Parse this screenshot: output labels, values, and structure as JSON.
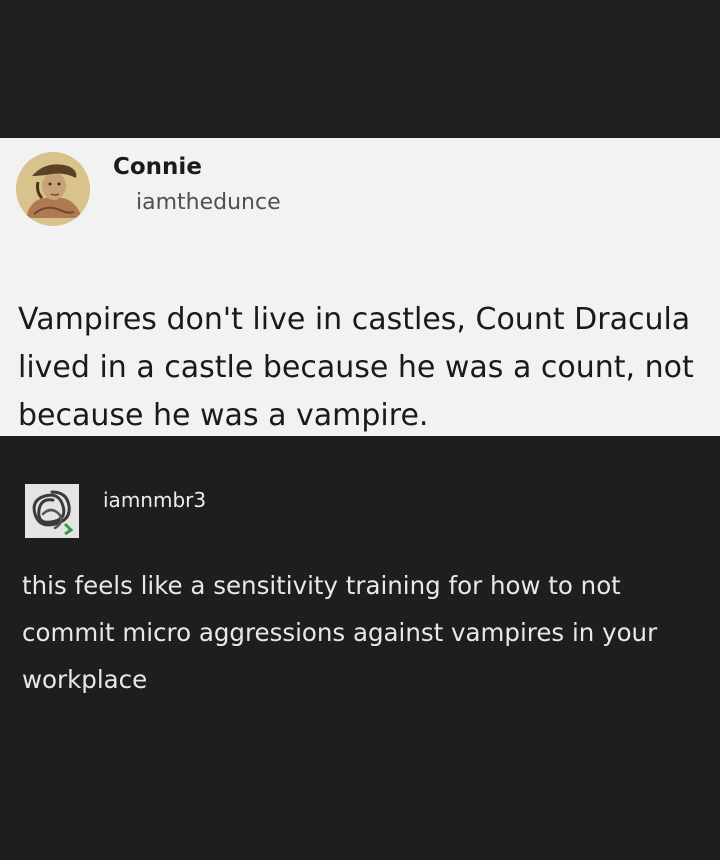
{
  "original_post": {
    "display_name": "Connie",
    "username": "iamthedunce",
    "text": "Vampires don't live in castles, Count Dracula lived in a castle because he was a count, not because he was a vampire.",
    "avatar_icon": "portrait-avatar-icon"
  },
  "reply": {
    "username": "iamnmbr3",
    "text": "this feels like a sensitivity training for how to not commit micro aggressions against vampires in your workplace",
    "avatar_icon": "knot-avatar-icon"
  },
  "colors": {
    "background_dark": "#1e1e1e",
    "card_light": "#f2f2f2",
    "text_dark": "#1a1a1a",
    "text_light": "#e8e8e8"
  }
}
